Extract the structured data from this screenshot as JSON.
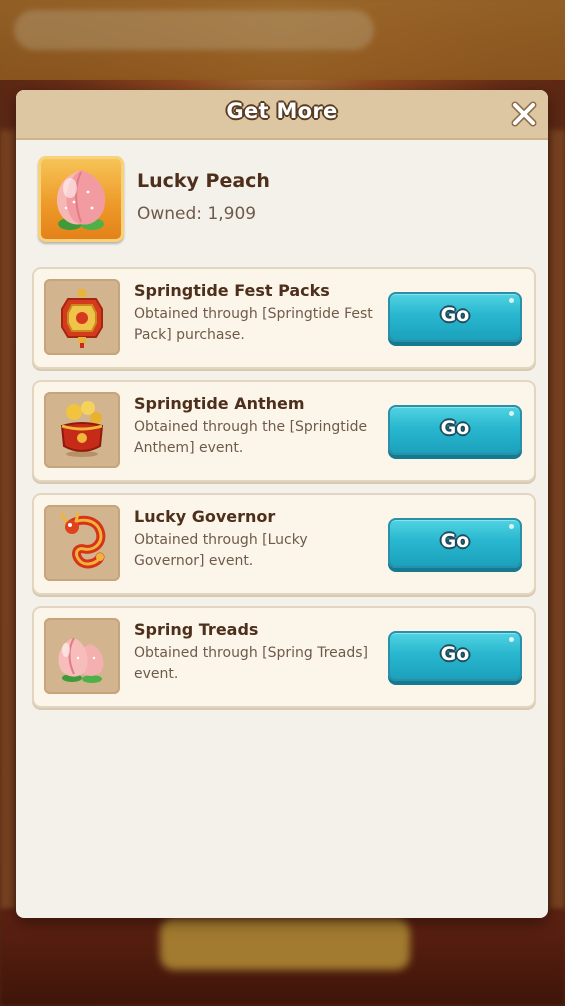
{
  "dialog": {
    "title": "Get More",
    "close_icon": "close-icon"
  },
  "item": {
    "name": "Lucky Peach",
    "owned_text": "Owned: 1,909",
    "owned_count": 1909,
    "icon": "peach-icon"
  },
  "sources": [
    {
      "title": "Springtide Fest Packs",
      "description": "Obtained through [Springtide Fest Pack] purchase.",
      "button_label": "Go",
      "icon": "lantern-icon"
    },
    {
      "title": "Springtide Anthem",
      "description": "Obtained through the [Springtide Anthem] event.",
      "button_label": "Go",
      "icon": "treasure-pot-icon"
    },
    {
      "title": "Lucky Governor",
      "description": "Obtained through [Lucky Governor] event.",
      "button_label": "Go",
      "icon": "dragon-icon"
    },
    {
      "title": "Spring Treads",
      "description": "Obtained through [Spring Treads] event.",
      "button_label": "Go",
      "icon": "peach-icon"
    }
  ],
  "colors": {
    "button_teal": "#29b7cf",
    "header_tan": "#dcc7a2",
    "title_brown": "#4d2f1c"
  }
}
